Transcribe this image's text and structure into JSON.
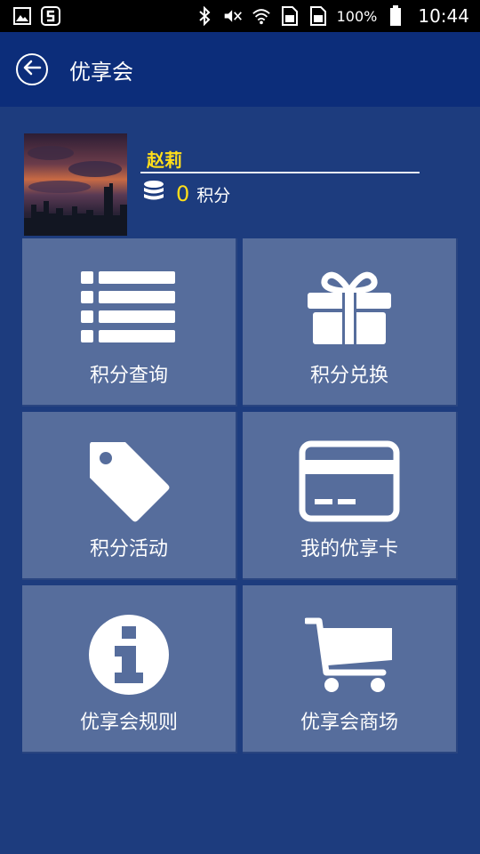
{
  "status_bar": {
    "battery_text": "100%",
    "time": "10:44",
    "icons": [
      "gallery-icon",
      "sogou-icon",
      "bluetooth-icon",
      "mute-icon",
      "wifi-icon",
      "sim-card-icon",
      "sim-card-icon",
      "battery-icon"
    ]
  },
  "app_bar": {
    "title": "优享会",
    "back_icon": "back-circle-arrow-icon"
  },
  "profile": {
    "name": "赵莉",
    "points_value": "0",
    "points_unit": "积分",
    "points_icon": "coins-stack-icon"
  },
  "tiles": [
    {
      "label": "积分查询",
      "icon": "list-icon"
    },
    {
      "label": "积分兑换",
      "icon": "gift-icon"
    },
    {
      "label": "积分活动",
      "icon": "tag-icon"
    },
    {
      "label": "我的优享卡",
      "icon": "card-icon"
    },
    {
      "label": "优享会规则",
      "icon": "info-icon"
    },
    {
      "label": "优享会商场",
      "icon": "cart-icon"
    }
  ],
  "colors": {
    "background": "#1d3c7e",
    "app_bar": "#0c2d7a",
    "tile": "#566d9c",
    "accent_yellow": "#ffde1a"
  }
}
